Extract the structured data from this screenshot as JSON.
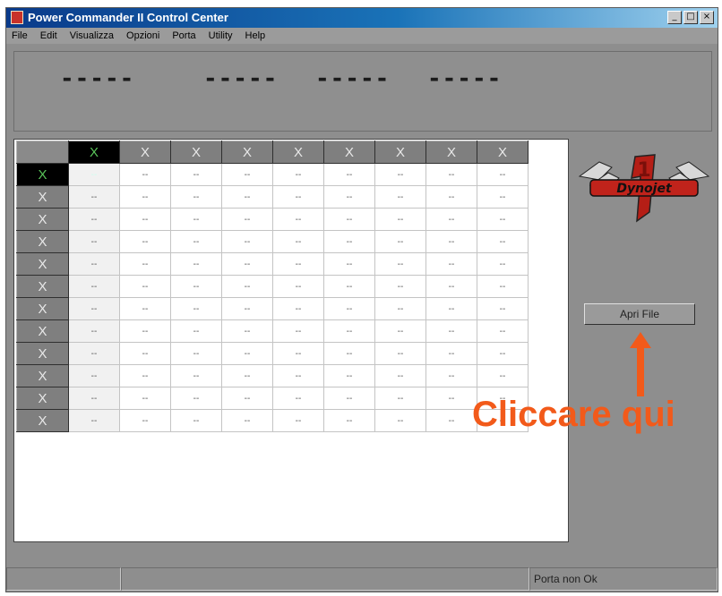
{
  "window": {
    "title": "Power Commander II Control Center",
    "minimize": "_",
    "maximize": "□",
    "close": "×"
  },
  "menu": [
    "File",
    "Edit",
    "Visualizza",
    "Opzioni",
    "Porta",
    "Utility",
    "Help"
  ],
  "readouts": [
    "-----",
    "-----",
    "-----",
    "-----"
  ],
  "grid": {
    "header_label": "X",
    "cell_value": "--",
    "columns": 9,
    "rows": 12,
    "selected_row": 0,
    "selected_col": 0
  },
  "logo": {
    "brand": "Dynojet",
    "number": "1"
  },
  "buttons": {
    "open_file": "Apri File"
  },
  "annotation": "Cliccare qui",
  "status": [
    "",
    "",
    "Porta non Ok"
  ],
  "colors": {
    "annotation": "#f25a1a",
    "selected_header": "#000000",
    "selected_cell": "#2c8fa0",
    "title_bar": "#0a3a8a"
  }
}
